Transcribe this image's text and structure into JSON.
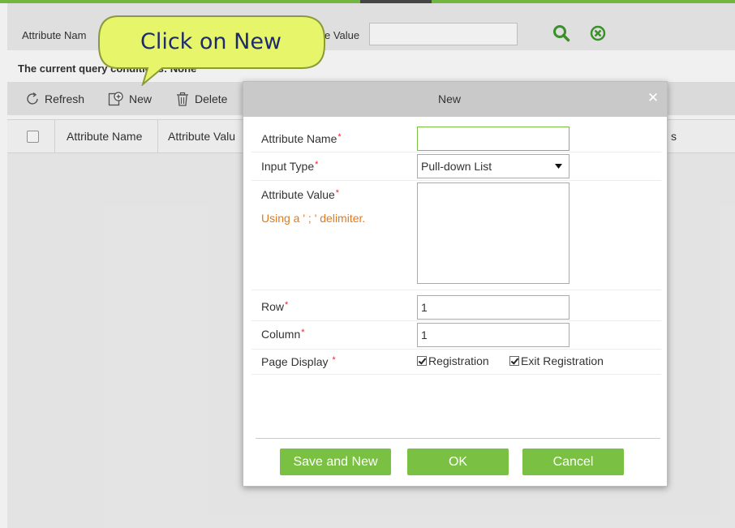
{
  "colors": {
    "accent": "#7ac143",
    "required": "#e22233",
    "hint": "#e07a20",
    "callout_fill": "#e6f56a"
  },
  "filter": {
    "attribute_name_label": "Attribute Nam",
    "attribute_value_label": "e Value",
    "attribute_value_input": ""
  },
  "query": {
    "text": "The current query conditions: None"
  },
  "toolbar": {
    "refresh_label": "Refresh",
    "new_label": "New",
    "delete_label": "Delete"
  },
  "grid": {
    "columns": [
      "Attribute Name",
      "Attribute Valu",
      "s"
    ]
  },
  "callout": {
    "text": "Click on New"
  },
  "dialog": {
    "title": "New",
    "close_glyph": "✕",
    "fields": {
      "attribute_name_label": "Attribute Name",
      "input_type_label": "Input Type",
      "attribute_value_label": "Attribute Value",
      "hint": "Using a ' ; ' delimiter.",
      "row_label": "Row",
      "column_label": "Column",
      "page_display_label": "Page Display",
      "required_mark": "*"
    },
    "values": {
      "attribute_name": "",
      "input_type": "Pull-down List",
      "attribute_value": "",
      "row": "1",
      "column": "1"
    },
    "checkboxes": [
      {
        "label": "Registration",
        "checked": true
      },
      {
        "label": "Exit Registration",
        "checked": true
      }
    ],
    "buttons": {
      "save_and_new": "Save and New",
      "ok": "OK",
      "cancel": "Cancel"
    }
  }
}
